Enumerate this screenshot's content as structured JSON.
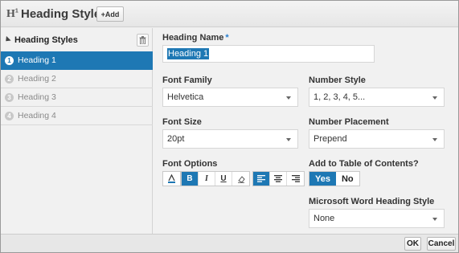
{
  "header": {
    "logo": "H",
    "logo_sup": "1",
    "title": "Heading Styles",
    "add_label": "+Add"
  },
  "sidebar": {
    "title": "Heading Styles",
    "items": [
      {
        "num": "1",
        "label": "Heading 1"
      },
      {
        "num": "2",
        "label": "Heading 2"
      },
      {
        "num": "3",
        "label": "Heading 3"
      },
      {
        "num": "4",
        "label": "Heading 4"
      }
    ]
  },
  "form": {
    "heading_name_label": "Heading Name",
    "required_mark": "*",
    "heading_name_value": "Heading 1",
    "font_family_label": "Font Family",
    "font_family_value": "Helvetica",
    "number_style_label": "Number Style",
    "number_style_value": "1, 2, 3, 4, 5...",
    "font_size_label": "Font Size",
    "font_size_value": "20pt",
    "number_placement_label": "Number Placement",
    "number_placement_value": "Prepend",
    "font_options_label": "Font Options",
    "font_options": {
      "bold": "B",
      "italic": "I",
      "underline": "U"
    },
    "toc_label": "Add to Table of Contents?",
    "toc_yes": "Yes",
    "toc_no": "No",
    "word_style_label": "Microsoft Word Heading Style",
    "word_style_value": "None"
  },
  "footer": {
    "ok_label": "OK",
    "cancel_label": "Cancel"
  },
  "colors": {
    "accent": "#1e78b4",
    "required": "#2a7fd0"
  }
}
